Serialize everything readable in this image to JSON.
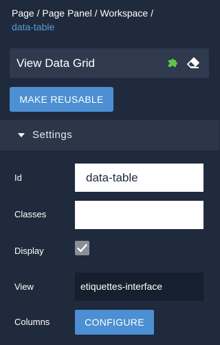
{
  "breadcrumb": {
    "items": [
      "Page",
      "Page Panel",
      "Workspace"
    ],
    "separator": "/",
    "current": "data-table"
  },
  "component": {
    "title": "View Data Grid",
    "icons": [
      "puzzle-icon",
      "eraser-icon"
    ]
  },
  "actions": {
    "make_reusable_label": "MAKE REUSABLE"
  },
  "settings": {
    "section_label": "Settings",
    "fields": {
      "id": {
        "label": "Id",
        "value": "data-table"
      },
      "classes": {
        "label": "Classes",
        "value": ""
      },
      "display": {
        "label": "Display",
        "checked": true
      },
      "view": {
        "label": "View",
        "value": "etiquettes-interface"
      },
      "columns": {
        "label": "Columns",
        "button_label": "CONFIGURE"
      }
    }
  },
  "colors": {
    "background": "#1f2a3c",
    "accent": "#4c8fd2",
    "link": "#5b9bd9",
    "puzzle_icon": "#5ec44a"
  }
}
